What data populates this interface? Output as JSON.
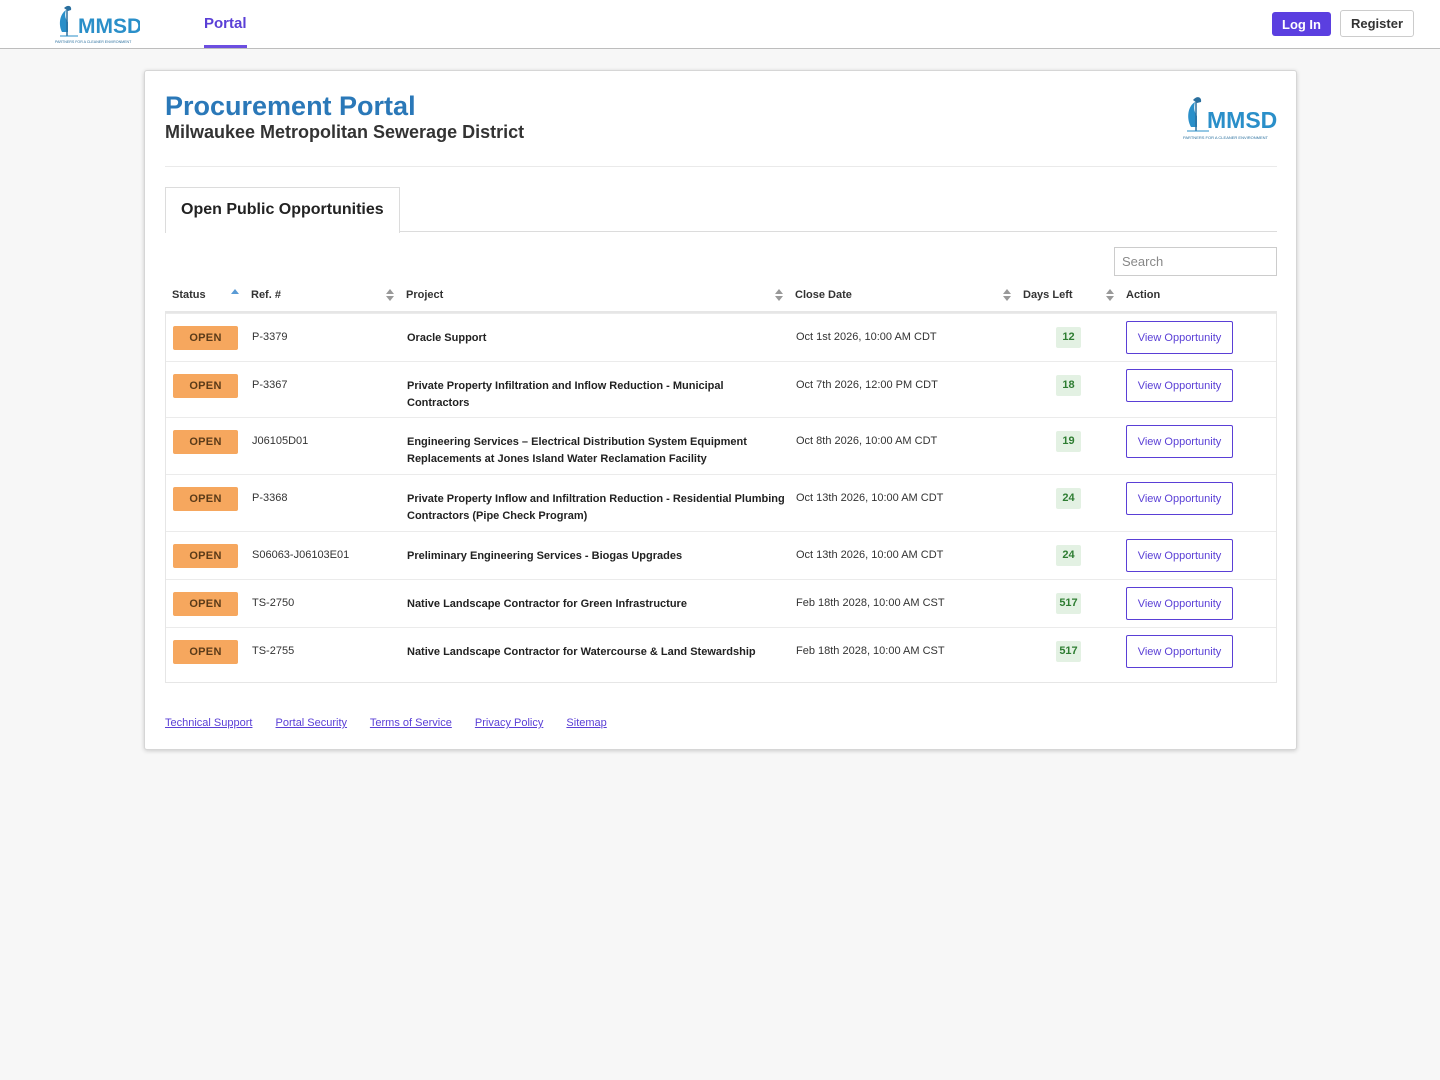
{
  "navbar": {
    "logo_text": "MMSD",
    "logo_tagline": "PARTNERS FOR A CLEANER ENVIRONMENT",
    "tab_label": "Portal",
    "login_label": "Log In",
    "register_label": "Register"
  },
  "header": {
    "title": "Procurement Portal",
    "subtitle": "Milwaukee Metropolitan Sewerage District"
  },
  "tabs": [
    {
      "label": "Open Public Opportunities",
      "active": true
    }
  ],
  "search": {
    "placeholder": "Search",
    "value": ""
  },
  "table": {
    "columns": [
      "Status",
      "Ref. #",
      "Project",
      "Close Date",
      "Days Left",
      "Action"
    ],
    "rows": [
      {
        "status": "OPEN",
        "ref": "P-3379",
        "project": "Oracle Support",
        "close_date": "Oct 1st 2026, 10:00 AM CDT",
        "days_left": "12",
        "action": "View Opportunity"
      },
      {
        "status": "OPEN",
        "ref": "P-3367",
        "project": "Private Property Infiltration and Inflow Reduction - Municipal Contractors",
        "close_date": "Oct 7th 2026, 12:00 PM CDT",
        "days_left": "18",
        "action": "View Opportunity"
      },
      {
        "status": "OPEN",
        "ref": "J06105D01",
        "project": "Engineering Services – Electrical Distribution System Equipment Replacements at Jones Island Water Reclamation Facility",
        "close_date": "Oct 8th 2026, 10:00 AM CDT",
        "days_left": "19",
        "action": "View Opportunity"
      },
      {
        "status": "OPEN",
        "ref": "P-3368",
        "project": "Private Property Inflow and Infiltration Reduction - Residential Plumbing Contractors (Pipe Check Program)",
        "close_date": "Oct 13th 2026, 10:00 AM CDT",
        "days_left": "24",
        "action": "View Opportunity"
      },
      {
        "status": "OPEN",
        "ref": "S06063-J06103E01",
        "project": "Preliminary Engineering Services - Biogas Upgrades",
        "close_date": "Oct 13th 2026, 10:00 AM CDT",
        "days_left": "24",
        "action": "View Opportunity"
      },
      {
        "status": "OPEN",
        "ref": "TS-2750",
        "project": "Native Landscape Contractor for Green Infrastructure",
        "close_date": "Feb 18th 2028, 10:00 AM CST",
        "days_left": "517",
        "action": "View Opportunity"
      },
      {
        "status": "OPEN",
        "ref": "TS-2755",
        "project": "Native Landscape Contractor for Watercourse & Land Stewardship",
        "close_date": "Feb 18th 2028, 10:00 AM CST",
        "days_left": "517",
        "action": "View Opportunity"
      }
    ]
  },
  "footer": {
    "links": [
      "Technical Support",
      "Portal Security",
      "Terms of Service",
      "Privacy Policy",
      "Sitemap"
    ]
  },
  "colors": {
    "accent": "#5b3fe0",
    "title_blue": "#2a78b8",
    "status_open": "#f6a75e",
    "days_left_bg": "#e3f1e3",
    "logo_blue": "#2a8fc9"
  }
}
